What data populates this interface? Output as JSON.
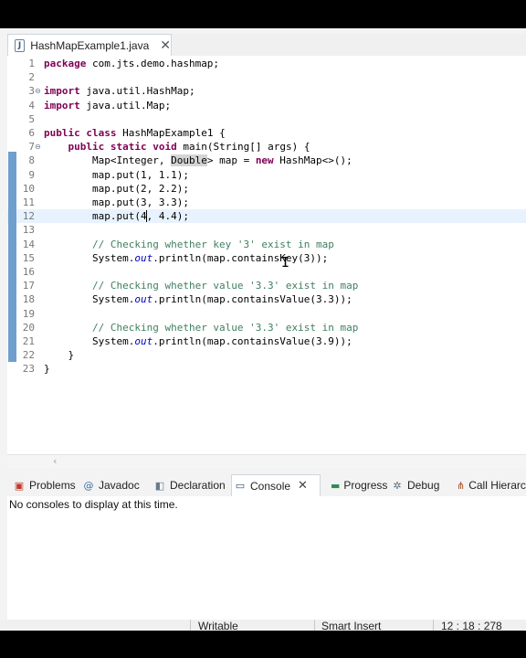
{
  "editor_tab": {
    "label": "HashMapExample1.java",
    "icon": "java-file-icon"
  },
  "code_lines": [
    {
      "n": "1",
      "seg": [
        {
          "t": "package",
          "c": "kw"
        },
        {
          "t": " com.jts.demo.hashmap;"
        }
      ]
    },
    {
      "n": "2",
      "seg": []
    },
    {
      "n": "3",
      "fold": "⊖",
      "seg": [
        {
          "t": "import",
          "c": "kw"
        },
        {
          "t": " java.util.HashMap;"
        }
      ]
    },
    {
      "n": "4",
      "seg": [
        {
          "t": "import",
          "c": "kw"
        },
        {
          "t": " java.util.Map;"
        }
      ]
    },
    {
      "n": "5",
      "seg": []
    },
    {
      "n": "6",
      "seg": [
        {
          "t": "public",
          "c": "kw"
        },
        {
          "t": " "
        },
        {
          "t": "class",
          "c": "kw"
        },
        {
          "t": " HashMapExample1 {"
        }
      ]
    },
    {
      "n": "7",
      "fold": "⊖",
      "seg": [
        {
          "t": "    "
        },
        {
          "t": "public",
          "c": "kw"
        },
        {
          "t": " "
        },
        {
          "t": "static",
          "c": "kw"
        },
        {
          "t": " "
        },
        {
          "t": "void",
          "c": "kw"
        },
        {
          "t": " main(String[] args) {"
        }
      ]
    },
    {
      "n": "8",
      "seg": [
        {
          "t": "        Map<Integer, "
        },
        {
          "t": "Double",
          "c": "hl"
        },
        {
          "t": "> map = "
        },
        {
          "t": "new",
          "c": "kw"
        },
        {
          "t": " HashMap<>();"
        }
      ]
    },
    {
      "n": "9",
      "seg": [
        {
          "t": "        map.put(1, 1.1);"
        }
      ]
    },
    {
      "n": "10",
      "seg": [
        {
          "t": "        map.put(2, 2.2);"
        }
      ]
    },
    {
      "n": "11",
      "seg": [
        {
          "t": "        map.put(3, 3.3);"
        }
      ]
    },
    {
      "n": "12",
      "current": true,
      "seg": [
        {
          "t": "        map.put(4"
        },
        {
          "t": "",
          "c": "cursor"
        },
        {
          "t": ", 4.4);"
        }
      ]
    },
    {
      "n": "13",
      "seg": []
    },
    {
      "n": "14",
      "seg": [
        {
          "t": "        "
        },
        {
          "t": "// Checking whether key '3' exist in map",
          "c": "cm"
        }
      ]
    },
    {
      "n": "15",
      "seg": [
        {
          "t": "        System."
        },
        {
          "t": "out",
          "c": "st"
        },
        {
          "t": ".println(map.containsKey(3));"
        }
      ]
    },
    {
      "n": "16",
      "seg": []
    },
    {
      "n": "17",
      "seg": [
        {
          "t": "        "
        },
        {
          "t": "// Checking whether value '3.3' exist in map",
          "c": "cm"
        }
      ]
    },
    {
      "n": "18",
      "seg": [
        {
          "t": "        System."
        },
        {
          "t": "out",
          "c": "st"
        },
        {
          "t": ".println(map.containsValue(3.3));"
        }
      ]
    },
    {
      "n": "19",
      "seg": []
    },
    {
      "n": "20",
      "seg": [
        {
          "t": "        "
        },
        {
          "t": "// Checking whether value '3.3' exist in map",
          "c": "cm"
        }
      ]
    },
    {
      "n": "21",
      "seg": [
        {
          "t": "        System."
        },
        {
          "t": "out",
          "c": "st"
        },
        {
          "t": ".println(map.containsValue(3.9));"
        }
      ]
    },
    {
      "n": "22",
      "seg": [
        {
          "t": "    }"
        }
      ]
    },
    {
      "n": "23",
      "seg": [
        {
          "t": "}"
        }
      ]
    }
  ],
  "panel_tabs": [
    {
      "label": "Problems",
      "icon": "problems-icon",
      "glyph": "▣",
      "color": "#c0392b"
    },
    {
      "label": "Javadoc",
      "icon": "javadoc-icon",
      "glyph": "@",
      "color": "#3a6ea5"
    },
    {
      "label": "Declaration",
      "icon": "declaration-icon",
      "glyph": "◧",
      "color": "#6b7b8c"
    },
    {
      "label": "Console",
      "icon": "console-icon",
      "glyph": "▭",
      "color": "#2c4f7c",
      "active": true
    },
    {
      "label": "Progress",
      "icon": "progress-icon",
      "glyph": "▬",
      "color": "#2e8b57"
    },
    {
      "label": "Debug",
      "icon": "debug-icon",
      "glyph": "✲",
      "color": "#5d6d7e"
    },
    {
      "label": "Call Hierarch",
      "icon": "call-hierarchy-icon",
      "glyph": "⋔",
      "color": "#a0522d"
    }
  ],
  "console": {
    "message": "No consoles to display at this time."
  },
  "status": {
    "writable": "Writable",
    "insert_mode": "Smart Insert",
    "position": "12 : 18 : 278"
  }
}
